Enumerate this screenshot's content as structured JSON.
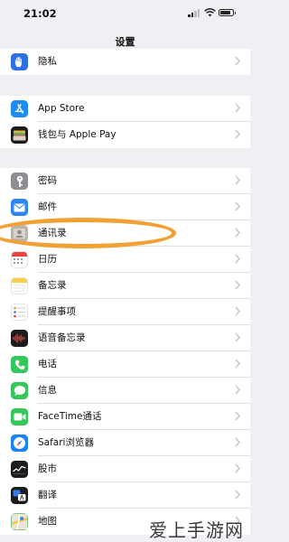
{
  "status_bar": {
    "time": "21:02",
    "battery_level": 0.85
  },
  "nav": {
    "title": "设置"
  },
  "groups": [
    {
      "items": [
        {
          "label": "隐私",
          "icon": "hand-icon",
          "color": "#2f6fe4"
        }
      ]
    },
    {
      "items": [
        {
          "label": "App Store",
          "icon": "app-store-icon",
          "color": "#1e8cf3"
        },
        {
          "label": "钱包与 Apple Pay",
          "icon": "wallet-icon",
          "color": "#1c1c1e"
        }
      ]
    },
    {
      "items": [
        {
          "label": "密码",
          "icon": "key-icon",
          "color": "#8e8e93"
        },
        {
          "label": "邮件",
          "icon": "mail-icon",
          "color": "#2d86f4"
        },
        {
          "label": "通讯录",
          "icon": "contacts-icon",
          "color": "#b9b5ad"
        },
        {
          "label": "日历",
          "icon": "calendar-icon",
          "color": "#ffffff"
        },
        {
          "label": "备忘录",
          "icon": "notes-icon",
          "color": "#ffffff"
        },
        {
          "label": "提醒事项",
          "icon": "reminders-icon",
          "color": "#ffffff"
        },
        {
          "label": "语音备忘录",
          "icon": "voice-memos-icon",
          "color": "#1c1c1e"
        },
        {
          "label": "电话",
          "icon": "phone-icon",
          "color": "#34c759"
        },
        {
          "label": "信息",
          "icon": "messages-icon",
          "color": "#34c759"
        },
        {
          "label": "FaceTime通话",
          "icon": "facetime-icon",
          "color": "#34c759"
        },
        {
          "label": "Safari浏览器",
          "icon": "safari-icon",
          "color": "#1a84f5"
        },
        {
          "label": "股市",
          "icon": "stocks-icon",
          "color": "#1c1c1e"
        },
        {
          "label": "翻译",
          "icon": "translate-icon",
          "color": "#1c1c1e"
        },
        {
          "label": "地图",
          "icon": "maps-icon",
          "color": "#7fc88a"
        }
      ]
    }
  ],
  "highlight": {
    "color": "#f2a033",
    "target": "通讯录"
  },
  "watermark": {
    "text": "爱上手游网"
  }
}
